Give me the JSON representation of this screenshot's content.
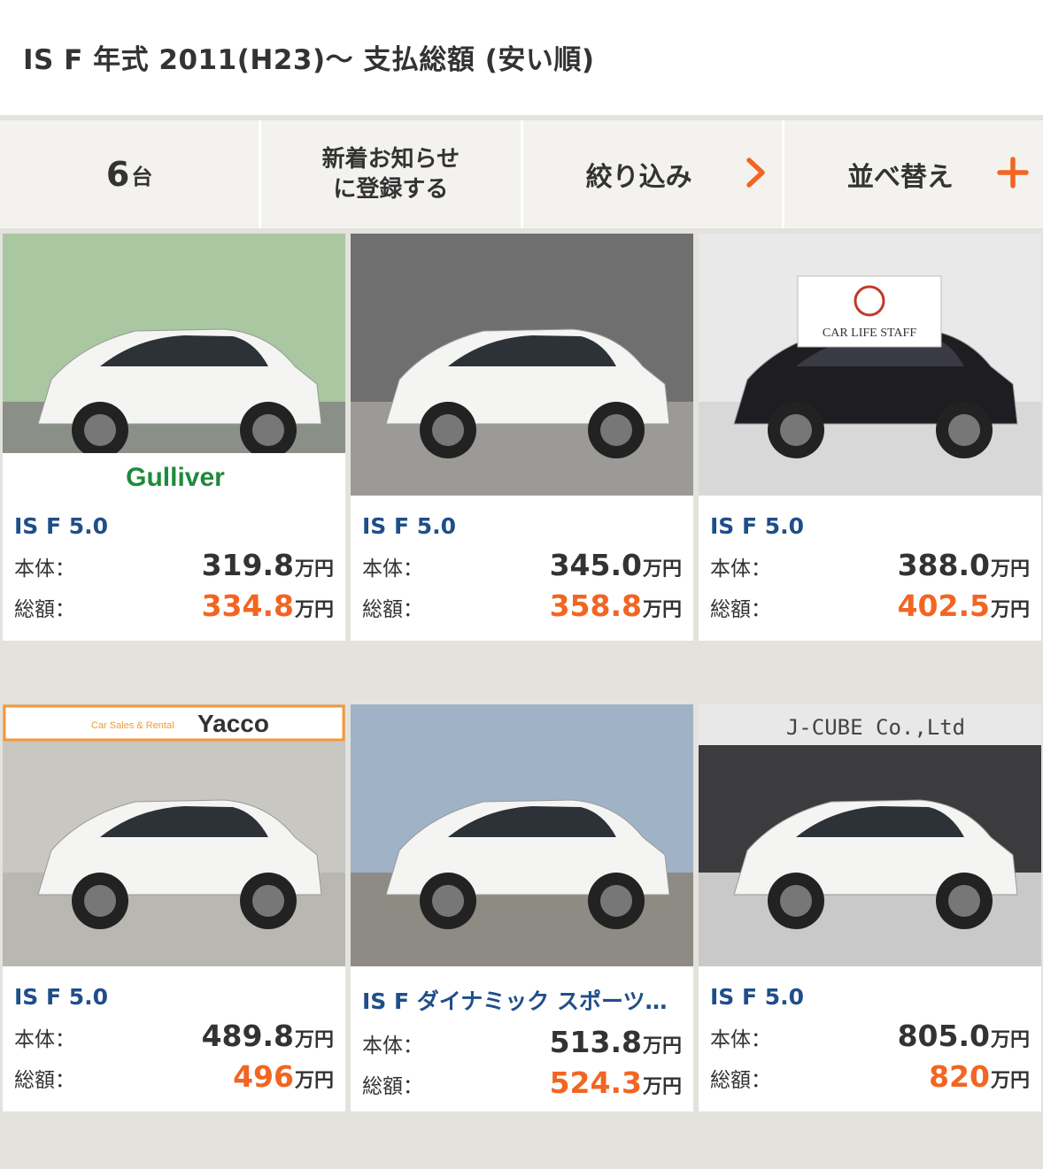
{
  "header": {
    "title": "IS F 年式 2011(H23)～ 支払総額 (安い順)"
  },
  "toolbar": {
    "count_number": "6",
    "count_unit": "台",
    "notify_line1": "新着お知らせ",
    "notify_line2": "に登録する",
    "filter_label": "絞り込み",
    "filter_icon": "chevron-right-icon",
    "sort_label": "並べ替え",
    "sort_icon": "plus-icon"
  },
  "labels": {
    "base": "本体：",
    "total": "総額：",
    "unit": "万円"
  },
  "colors": {
    "accent": "#f26522",
    "link": "#1f4e8a",
    "background": "#e4e2dd"
  },
  "listings": [
    {
      "name": "IS F 5.0",
      "base": "319.8",
      "total": "334.8",
      "dealer_logo": "Gulliver",
      "car_color": "white"
    },
    {
      "name": "IS F 5.0",
      "base": "345.0",
      "total": "358.8",
      "dealer_logo": "",
      "car_color": "white"
    },
    {
      "name": "IS F 5.0",
      "base": "388.0",
      "total": "402.5",
      "dealer_logo": "CAR LIFE STAFF",
      "car_color": "black"
    },
    {
      "name": "IS F 5.0",
      "base": "489.8",
      "total": "496",
      "dealer_logo": "Yacco",
      "dealer_sub": "Car Sales & Rental",
      "car_color": "white"
    },
    {
      "name": "IS F ダイナミック スポーツ…",
      "base": "513.8",
      "total": "524.3",
      "dealer_logo": "",
      "car_color": "white"
    },
    {
      "name": "IS F 5.0",
      "base": "805.0",
      "total": "820",
      "dealer_logo": "J-CUBE Co.,Ltd",
      "car_color": "white"
    }
  ]
}
